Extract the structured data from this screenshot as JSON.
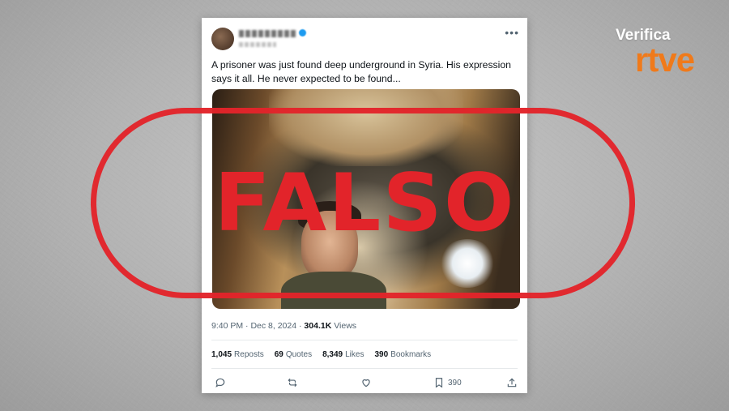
{
  "tweet": {
    "text": "A prisoner was just found deep underground in Syria. His expression says it all. He never expected to be found...",
    "more_icon": "more-horizontal-icon",
    "time": "9:40 PM",
    "sep1": "·",
    "date": "Dec 8, 2024",
    "sep2": "·",
    "views_count": "304.1K",
    "views_label": "Views",
    "stats": {
      "reposts_count": "1,045",
      "reposts_label": "Reposts",
      "quotes_count": "69",
      "quotes_label": "Quotes",
      "likes_count": "8,349",
      "likes_label": "Likes",
      "bookmarks_count": "390",
      "bookmarks_label": "Bookmarks"
    },
    "actions": {
      "reply_icon": "reply-icon",
      "repost_icon": "repost-icon",
      "like_icon": "heart-icon",
      "bookmark_icon": "bookmark-icon",
      "bookmark_count": "390",
      "share_icon": "share-icon"
    }
  },
  "stamp": {
    "text": "FALSO",
    "color": "#e2242a"
  },
  "logo": {
    "line1": "Verifica",
    "line2": "rtve",
    "accent": "#f07a1a"
  }
}
